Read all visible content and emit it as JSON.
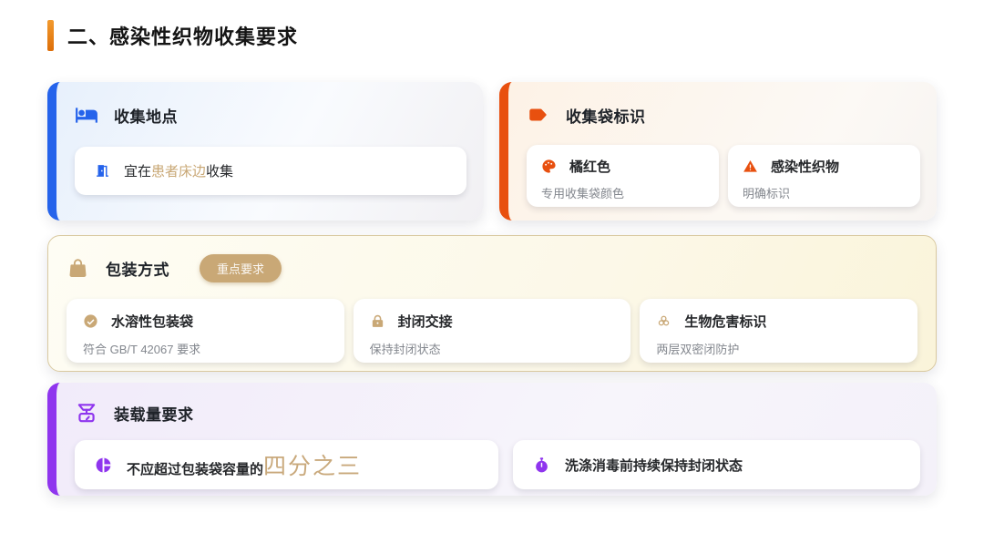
{
  "title": "二、感染性织物收集要求",
  "colors": {
    "accent_orange": "#E8790F",
    "blue": "#2563EB",
    "orange_red": "#E8500F",
    "tan": "#C9A876",
    "purple": "#8F35EE",
    "text_dark": "#1F2329",
    "text_gray": "#83878E"
  },
  "cards": {
    "location": {
      "title": "收集地点",
      "icon": "bed-icon",
      "item": {
        "icon": "door-icon",
        "prefix": "宜在",
        "highlight": "患者床边",
        "suffix": "收集"
      }
    },
    "bag_label": {
      "title": "收集袋标识",
      "icon": "tag-icon",
      "items": [
        {
          "icon": "palette-icon",
          "title": "橘红色",
          "desc": "专用收集袋颜色"
        },
        {
          "icon": "warning-icon",
          "title": "感染性织物",
          "desc": "明确标识"
        }
      ]
    },
    "packaging": {
      "title": "包装方式",
      "icon": "shopping-bag-icon",
      "badge": "重点要求",
      "items": [
        {
          "icon": "check-circle-icon",
          "title": "水溶性包装袋",
          "desc": "符合 GB/T 42067 要求"
        },
        {
          "icon": "lock-icon",
          "title": "封闭交接",
          "desc": "保持封闭状态"
        },
        {
          "icon": "biohazard-icon",
          "title": "生物危害标识",
          "desc": "两层双密闭防护"
        }
      ]
    },
    "load": {
      "title": "装载量要求",
      "icon": "scale-icon",
      "items": [
        {
          "icon": "pie-chart-icon",
          "prefix": "不应超过包装袋容量的",
          "highlight": "四分之三"
        },
        {
          "icon": "stopwatch-icon",
          "text": "洗涤消毒前持续保持封闭状态"
        }
      ]
    }
  }
}
